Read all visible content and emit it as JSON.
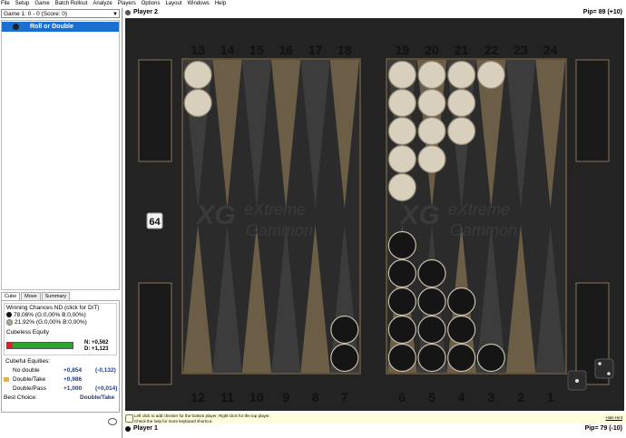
{
  "menu": [
    "File",
    "Setup",
    "Game",
    "Batch Rollout",
    "Analyze",
    "Players",
    "Options",
    "Layout",
    "Windows",
    "Help"
  ],
  "game_select": "Game 1: 0 - 0 (Score: 0)",
  "movelist": {
    "selected": "Roll or Double"
  },
  "tabs": [
    "Cube",
    "Move",
    "Summary"
  ],
  "analysis": {
    "chances_title": "Winning Chances ND (click for D/T)",
    "p_top": "78,08% (G:0,00% B:0,00%)",
    "p_bottom": "21,92% (G:0,00% B:0,00%)",
    "cubeless_label": "Cubeless Equity",
    "n_value": "N: +0,562",
    "d_value": "D: +1,123",
    "cubeful_label": "Cubeful Equities:",
    "rows": [
      {
        "label": "No double",
        "eq": "+0,854",
        "diff": "(-0,132)"
      },
      {
        "label": "Double/Take",
        "eq": "+0,986",
        "diff": ""
      },
      {
        "label": "Double/Pass",
        "eq": "+1,000",
        "diff": "(+0,014)"
      }
    ],
    "best_label": "Best Choice:",
    "best_value": "Double/Take"
  },
  "player_top": {
    "name": "Player 2",
    "pip": "Pip= 89 (+10)"
  },
  "player_bottom": {
    "name": "Player 1",
    "pip": "Pip= 79 (-10)"
  },
  "board": {
    "top_numbers": [
      "13",
      "14",
      "15",
      "16",
      "17",
      "18",
      "19",
      "20",
      "21",
      "22",
      "23",
      "24"
    ],
    "bottom_numbers": [
      "12",
      "11",
      "10",
      "9",
      "8",
      "7",
      "6",
      "5",
      "4",
      "3",
      "2",
      "1"
    ],
    "watermark_line1": "eXtreme",
    "watermark_line2": "Gammon",
    "watermark_logo": "XG",
    "cube_value": "64",
    "light_checkers": {
      "13": 2,
      "19": 5,
      "20": 4,
      "21": 3,
      "22": 1
    },
    "dark_checkers": {
      "7": 2,
      "6": 5,
      "5": 4,
      "4": 3,
      "3": 1
    },
    "colors": {
      "frame": "#5b4e3a",
      "dark_point": "#3c3c3c",
      "light_point": "#6b5d46",
      "checker_light": "#d9cfbd",
      "checker_dark": "#151515"
    }
  },
  "hint": {
    "line1": "Left click to add checker for the bottom player, Right-click for the top player.",
    "line2": "Check the help for more keyboard shortcut.",
    "hide": "Hide Hint"
  }
}
